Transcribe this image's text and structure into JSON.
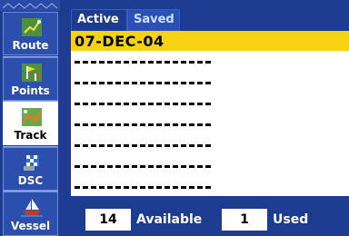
{
  "sidebar": {
    "items": [
      {
        "label": "Route",
        "icon": "route-icon"
      },
      {
        "label": "Points",
        "icon": "points-icon"
      },
      {
        "label": "Track",
        "icon": "track-icon"
      },
      {
        "label": "DSC",
        "icon": "dsc-icon"
      },
      {
        "label": "Vessel",
        "icon": "vessel-icon"
      }
    ],
    "active_index": 2
  },
  "tabs": [
    {
      "label": "Active"
    },
    {
      "label": "Saved"
    }
  ],
  "track_list": {
    "selected": "07-DEC-04",
    "empty_slot_count": 7
  },
  "status": {
    "available_value": "14",
    "available_label": "Available",
    "used_value": "1",
    "used_label": "Used"
  },
  "colors": {
    "background": "#1d3b8f",
    "highlight": "#f7d211"
  }
}
